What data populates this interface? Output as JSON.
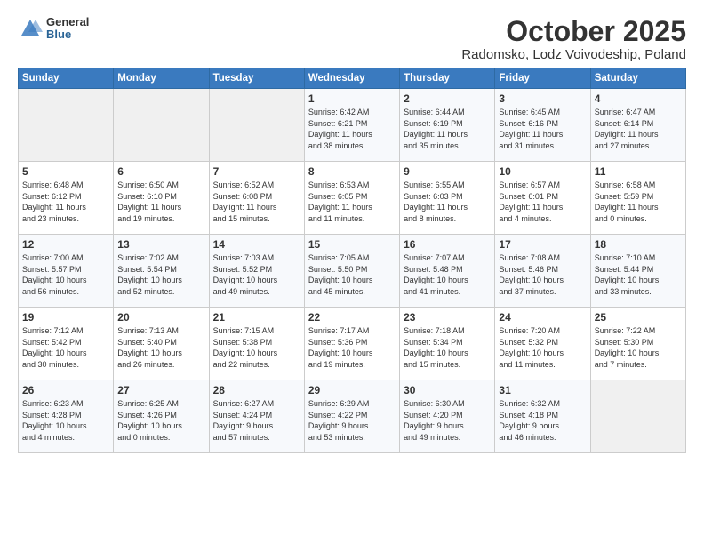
{
  "header": {
    "logo_general": "General",
    "logo_blue": "Blue",
    "month_title": "October 2025",
    "location": "Radomsko, Lodz Voivodeship, Poland"
  },
  "days_of_week": [
    "Sunday",
    "Monday",
    "Tuesday",
    "Wednesday",
    "Thursday",
    "Friday",
    "Saturday"
  ],
  "weeks": [
    [
      {
        "day": "",
        "info": ""
      },
      {
        "day": "",
        "info": ""
      },
      {
        "day": "",
        "info": ""
      },
      {
        "day": "1",
        "info": "Sunrise: 6:42 AM\nSunset: 6:21 PM\nDaylight: 11 hours\nand 38 minutes."
      },
      {
        "day": "2",
        "info": "Sunrise: 6:44 AM\nSunset: 6:19 PM\nDaylight: 11 hours\nand 35 minutes."
      },
      {
        "day": "3",
        "info": "Sunrise: 6:45 AM\nSunset: 6:16 PM\nDaylight: 11 hours\nand 31 minutes."
      },
      {
        "day": "4",
        "info": "Sunrise: 6:47 AM\nSunset: 6:14 PM\nDaylight: 11 hours\nand 27 minutes."
      }
    ],
    [
      {
        "day": "5",
        "info": "Sunrise: 6:48 AM\nSunset: 6:12 PM\nDaylight: 11 hours\nand 23 minutes."
      },
      {
        "day": "6",
        "info": "Sunrise: 6:50 AM\nSunset: 6:10 PM\nDaylight: 11 hours\nand 19 minutes."
      },
      {
        "day": "7",
        "info": "Sunrise: 6:52 AM\nSunset: 6:08 PM\nDaylight: 11 hours\nand 15 minutes."
      },
      {
        "day": "8",
        "info": "Sunrise: 6:53 AM\nSunset: 6:05 PM\nDaylight: 11 hours\nand 11 minutes."
      },
      {
        "day": "9",
        "info": "Sunrise: 6:55 AM\nSunset: 6:03 PM\nDaylight: 11 hours\nand 8 minutes."
      },
      {
        "day": "10",
        "info": "Sunrise: 6:57 AM\nSunset: 6:01 PM\nDaylight: 11 hours\nand 4 minutes."
      },
      {
        "day": "11",
        "info": "Sunrise: 6:58 AM\nSunset: 5:59 PM\nDaylight: 11 hours\nand 0 minutes."
      }
    ],
    [
      {
        "day": "12",
        "info": "Sunrise: 7:00 AM\nSunset: 5:57 PM\nDaylight: 10 hours\nand 56 minutes."
      },
      {
        "day": "13",
        "info": "Sunrise: 7:02 AM\nSunset: 5:54 PM\nDaylight: 10 hours\nand 52 minutes."
      },
      {
        "day": "14",
        "info": "Sunrise: 7:03 AM\nSunset: 5:52 PM\nDaylight: 10 hours\nand 49 minutes."
      },
      {
        "day": "15",
        "info": "Sunrise: 7:05 AM\nSunset: 5:50 PM\nDaylight: 10 hours\nand 45 minutes."
      },
      {
        "day": "16",
        "info": "Sunrise: 7:07 AM\nSunset: 5:48 PM\nDaylight: 10 hours\nand 41 minutes."
      },
      {
        "day": "17",
        "info": "Sunrise: 7:08 AM\nSunset: 5:46 PM\nDaylight: 10 hours\nand 37 minutes."
      },
      {
        "day": "18",
        "info": "Sunrise: 7:10 AM\nSunset: 5:44 PM\nDaylight: 10 hours\nand 33 minutes."
      }
    ],
    [
      {
        "day": "19",
        "info": "Sunrise: 7:12 AM\nSunset: 5:42 PM\nDaylight: 10 hours\nand 30 minutes."
      },
      {
        "day": "20",
        "info": "Sunrise: 7:13 AM\nSunset: 5:40 PM\nDaylight: 10 hours\nand 26 minutes."
      },
      {
        "day": "21",
        "info": "Sunrise: 7:15 AM\nSunset: 5:38 PM\nDaylight: 10 hours\nand 22 minutes."
      },
      {
        "day": "22",
        "info": "Sunrise: 7:17 AM\nSunset: 5:36 PM\nDaylight: 10 hours\nand 19 minutes."
      },
      {
        "day": "23",
        "info": "Sunrise: 7:18 AM\nSunset: 5:34 PM\nDaylight: 10 hours\nand 15 minutes."
      },
      {
        "day": "24",
        "info": "Sunrise: 7:20 AM\nSunset: 5:32 PM\nDaylight: 10 hours\nand 11 minutes."
      },
      {
        "day": "25",
        "info": "Sunrise: 7:22 AM\nSunset: 5:30 PM\nDaylight: 10 hours\nand 7 minutes."
      }
    ],
    [
      {
        "day": "26",
        "info": "Sunrise: 6:23 AM\nSunset: 4:28 PM\nDaylight: 10 hours\nand 4 minutes."
      },
      {
        "day": "27",
        "info": "Sunrise: 6:25 AM\nSunset: 4:26 PM\nDaylight: 10 hours\nand 0 minutes."
      },
      {
        "day": "28",
        "info": "Sunrise: 6:27 AM\nSunset: 4:24 PM\nDaylight: 9 hours\nand 57 minutes."
      },
      {
        "day": "29",
        "info": "Sunrise: 6:29 AM\nSunset: 4:22 PM\nDaylight: 9 hours\nand 53 minutes."
      },
      {
        "day": "30",
        "info": "Sunrise: 6:30 AM\nSunset: 4:20 PM\nDaylight: 9 hours\nand 49 minutes."
      },
      {
        "day": "31",
        "info": "Sunrise: 6:32 AM\nSunset: 4:18 PM\nDaylight: 9 hours\nand 46 minutes."
      },
      {
        "day": "",
        "info": ""
      }
    ]
  ]
}
